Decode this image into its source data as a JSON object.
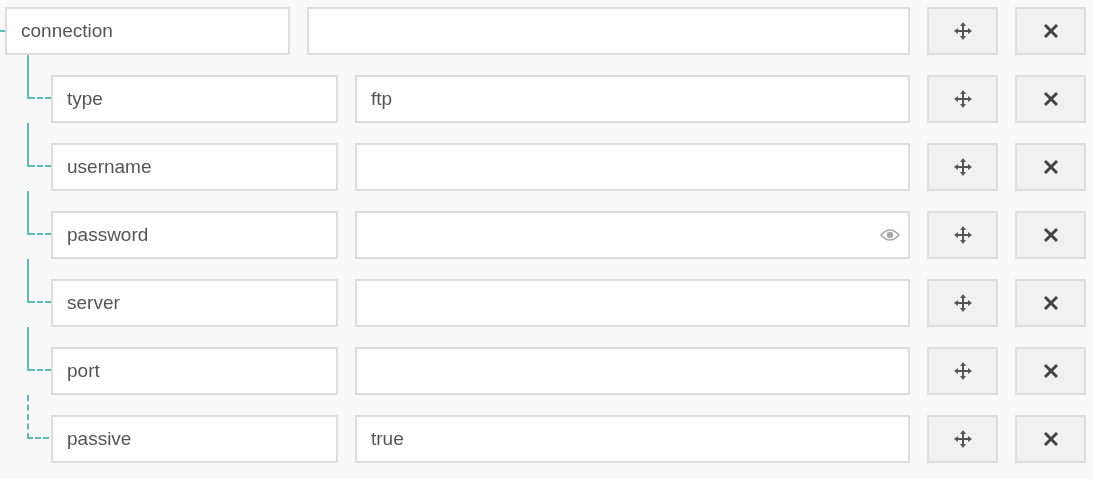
{
  "root": {
    "key": "connection",
    "children": [
      {
        "key": "type",
        "value": "ftp",
        "kind": "text"
      },
      {
        "key": "username",
        "kind": "text"
      },
      {
        "key": "password",
        "kind": "password"
      },
      {
        "key": "server",
        "kind": "text"
      },
      {
        "key": "port",
        "kind": "text"
      },
      {
        "key": "passive",
        "value": "true",
        "kind": "text"
      }
    ]
  }
}
